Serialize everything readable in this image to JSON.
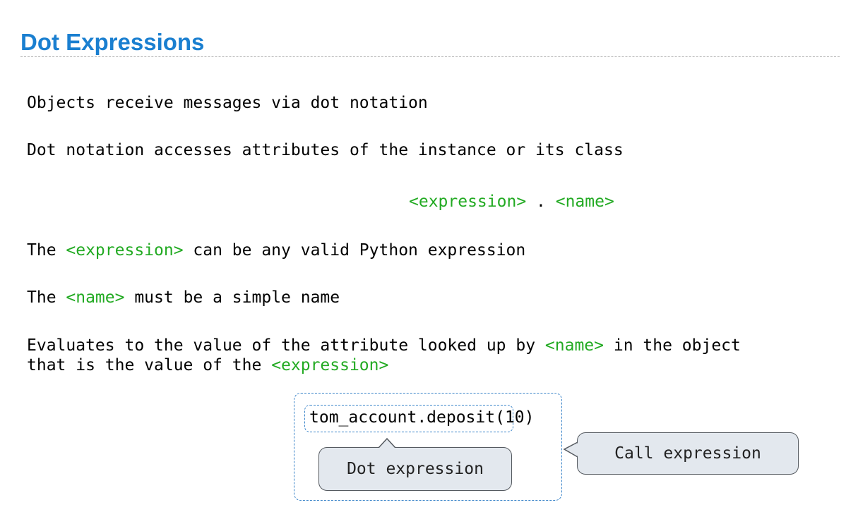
{
  "title": "Dot Expressions",
  "lines": {
    "l1": "Objects receive messages via dot notation",
    "l2": "Dot notation accesses attributes of the instance or its class",
    "syntax": {
      "expression": "<expression>",
      "dot": " . ",
      "name": "<name>"
    },
    "l3": {
      "pre": "The ",
      "expr": "<expression>",
      "post": " can be any valid Python expression"
    },
    "l4": {
      "pre": "The ",
      "name": "<name>",
      "post": " must be a simple name"
    },
    "l5": {
      "pre": "Evaluates to the value of the attribute looked up by ",
      "name": "<name>",
      "post": " in the object"
    },
    "l6": {
      "pre": "that is the value of the ",
      "expr": "<expression>"
    }
  },
  "diagram": {
    "code_dot": "tom_account.deposit",
    "code_args": "(10)",
    "dot_label": "Dot expression",
    "call_label": "Call expression"
  },
  "colors": {
    "title": "#1a7fd0",
    "highlight": "#22aa22",
    "box_border": "#3a84c9",
    "callout_fill": "#e3e8ee"
  }
}
